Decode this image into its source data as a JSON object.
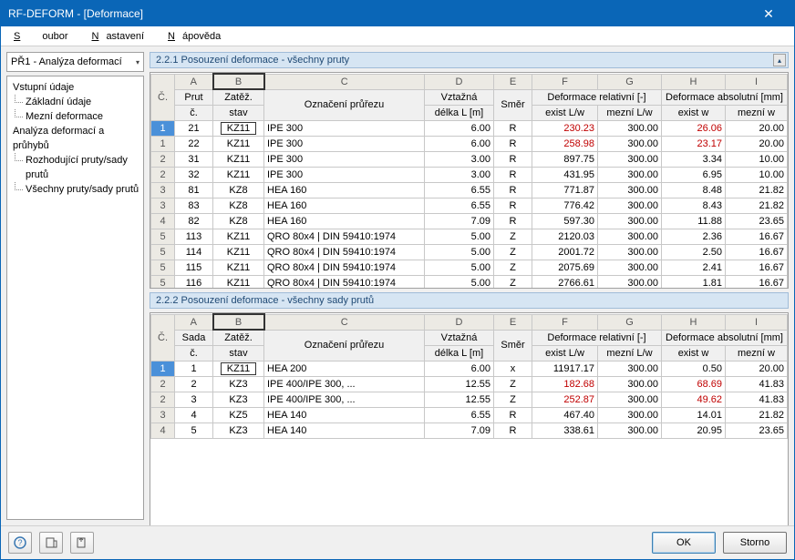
{
  "window": {
    "title": "RF-DEFORM - [Deformace]",
    "close": "✕"
  },
  "menu": {
    "m1": "Soubor",
    "m2": "Nastavení",
    "m3": "Nápověda"
  },
  "combo": {
    "text": "PŘ1 - Analýza deformací"
  },
  "tree": {
    "g1": "Vstupní údaje",
    "i1": "Základní údaje",
    "i2": "Mezní deformace",
    "g2": "Analýza deformací a průhybů",
    "i3": "Rozhodující pruty/sady prutů",
    "i4": "Všechny pruty/sady prutů"
  },
  "section1_title": "2.2.1 Posouzení deformace - všechny pruty",
  "section2_title": "2.2.2 Posouzení deformace - všechny sady prutů",
  "letters": {
    "A": "A",
    "B": "B",
    "C": "C",
    "D": "D",
    "E": "E",
    "F": "F",
    "G": "G",
    "H": "H",
    "I": "I"
  },
  "head1": {
    "idx": "Č.",
    "a": "Prut č.",
    "b": "Zatěž. stav",
    "c": "Označení průřezu",
    "d": "Vztažná délka L [m]",
    "e": "Směr",
    "fg": "Deformace relativní [-]",
    "f": "exist L/w",
    "g": "mezní L/w",
    "hi": "Deformace absolutní [mm]",
    "h": "exist w",
    "i": "mezní w"
  },
  "head2": {
    "idx": "Č.",
    "a": "Sada č.",
    "b": "Zatěž. stav",
    "c": "Označení průřezu",
    "d": "Vztažná délka L [m]",
    "e": "Směr",
    "fg": "Deformace relativní [-]",
    "f": "exist L/w",
    "g": "mezní L/w",
    "hi": "Deformace absolutní [mm]",
    "h": "exist w",
    "i": "mezní w"
  },
  "rows1": [
    {
      "idx": "1",
      "a": "21",
      "b": "KZ11",
      "c": "IPE 300",
      "d": "6.00",
      "e": "R",
      "f": "230.23",
      "g": "300.00",
      "h": "26.06",
      "i": "20.00",
      "fr": true,
      "hr": true,
      "sel": true
    },
    {
      "idx": "1",
      "a": "22",
      "b": "KZ11",
      "c": "IPE 300",
      "d": "6.00",
      "e": "R",
      "f": "258.98",
      "g": "300.00",
      "h": "23.17",
      "i": "20.00",
      "fr": true,
      "hr": true
    },
    {
      "idx": "2",
      "a": "31",
      "b": "KZ11",
      "c": "IPE 300",
      "d": "3.00",
      "e": "R",
      "f": "897.75",
      "g": "300.00",
      "h": "3.34",
      "i": "10.00"
    },
    {
      "idx": "2",
      "a": "32",
      "b": "KZ11",
      "c": "IPE 300",
      "d": "3.00",
      "e": "R",
      "f": "431.95",
      "g": "300.00",
      "h": "6.95",
      "i": "10.00"
    },
    {
      "idx": "3",
      "a": "81",
      "b": "KZ8",
      "c": "HEA 160",
      "d": "6.55",
      "e": "R",
      "f": "771.87",
      "g": "300.00",
      "h": "8.48",
      "i": "21.82"
    },
    {
      "idx": "3",
      "a": "83",
      "b": "KZ8",
      "c": "HEA 160",
      "d": "6.55",
      "e": "R",
      "f": "776.42",
      "g": "300.00",
      "h": "8.43",
      "i": "21.82"
    },
    {
      "idx": "4",
      "a": "82",
      "b": "KZ8",
      "c": "HEA 160",
      "d": "7.09",
      "e": "R",
      "f": "597.30",
      "g": "300.00",
      "h": "11.88",
      "i": "23.65"
    },
    {
      "idx": "5",
      "a": "113",
      "b": "KZ11",
      "c": "QRO 80x4 | DIN 59410:1974",
      "d": "5.00",
      "e": "Z",
      "f": "2120.03",
      "g": "300.00",
      "h": "2.36",
      "i": "16.67"
    },
    {
      "idx": "5",
      "a": "114",
      "b": "KZ11",
      "c": "QRO 80x4 | DIN 59410:1974",
      "d": "5.00",
      "e": "Z",
      "f": "2001.72",
      "g": "300.00",
      "h": "2.50",
      "i": "16.67"
    },
    {
      "idx": "5",
      "a": "115",
      "b": "KZ11",
      "c": "QRO 80x4 | DIN 59410:1974",
      "d": "5.00",
      "e": "Z",
      "f": "2075.69",
      "g": "300.00",
      "h": "2.41",
      "i": "16.67"
    },
    {
      "idx": "5",
      "a": "116",
      "b": "KZ11",
      "c": "QRO 80x4 | DIN 59410:1974",
      "d": "5.00",
      "e": "Z",
      "f": "2766.61",
      "g": "300.00",
      "h": "1.81",
      "i": "16.67"
    }
  ],
  "rows2": [
    {
      "idx": "1",
      "a": "1",
      "b": "KZ11",
      "c": "HEA 200",
      "d": "6.00",
      "e": "x",
      "f": "11917.17",
      "g": "300.00",
      "h": "0.50",
      "i": "20.00",
      "sel": true
    },
    {
      "idx": "2",
      "a": "2",
      "b": "KZ3",
      "c": "IPE 400/IPE 300, ...",
      "d": "12.55",
      "e": "Z",
      "f": "182.68",
      "g": "300.00",
      "h": "68.69",
      "i": "41.83",
      "fr": true,
      "hr": true
    },
    {
      "idx": "2",
      "a": "3",
      "b": "KZ3",
      "c": "IPE 400/IPE 300, ...",
      "d": "12.55",
      "e": "Z",
      "f": "252.87",
      "g": "300.00",
      "h": "49.62",
      "i": "41.83",
      "fr": true,
      "hr": true
    },
    {
      "idx": "3",
      "a": "4",
      "b": "KZ5",
      "c": "HEA 140",
      "d": "6.55",
      "e": "R",
      "f": "467.40",
      "g": "300.00",
      "h": "14.01",
      "i": "21.82"
    },
    {
      "idx": "4",
      "a": "5",
      "b": "KZ3",
      "c": "HEA 140",
      "d": "7.09",
      "e": "R",
      "f": "338.61",
      "g": "300.00",
      "h": "20.95",
      "i": "23.65"
    }
  ],
  "footer": {
    "ok": "OK",
    "cancel": "Storno"
  }
}
